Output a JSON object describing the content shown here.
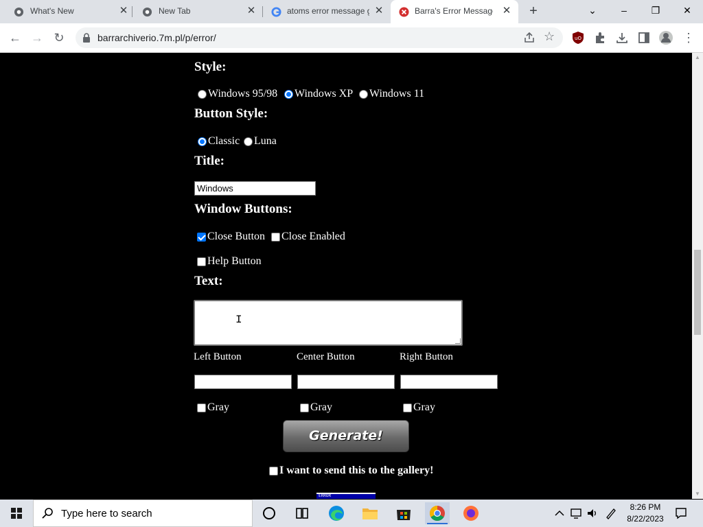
{
  "browser": {
    "tabs": [
      {
        "title": "What's New"
      },
      {
        "title": "New Tab"
      },
      {
        "title": "atoms error message g"
      },
      {
        "title": "Barra's Error Message G"
      }
    ],
    "url": "barrarchiverio.7m.pl/p/error/"
  },
  "form": {
    "style_label": "Style:",
    "style_options": [
      "Windows 95/98",
      "Windows XP",
      "Windows 11"
    ],
    "style_selected": "Windows XP",
    "button_style_label": "Button Style:",
    "button_style_options": [
      "Classic",
      "Luna"
    ],
    "button_style_selected": "Classic",
    "title_label": "Title:",
    "title_value": "Windows",
    "window_buttons_label": "Window Buttons:",
    "close_button_label": "Close Button",
    "close_button_checked": true,
    "close_enabled_label": "Close Enabled",
    "close_enabled_checked": false,
    "help_button_label": "Help Button",
    "help_button_checked": false,
    "text_label": "Text:",
    "text_value": "",
    "left_button_label": "Left Button",
    "center_button_label": "Center Button",
    "right_button_label": "Right Button",
    "gray_label": "Gray",
    "generate_label": "Generate!",
    "gallery_label": "I want to send this to the gallery!",
    "preview_text": "ERROR"
  },
  "taskbar": {
    "search_placeholder": "Type here to search",
    "time": "8:26 PM",
    "date": "8/22/2023"
  },
  "colors": {
    "accent": "#0075ff",
    "page_bg": "#000000",
    "tab_strip": "#dee1e6",
    "taskbar": "#dfe3ea"
  }
}
